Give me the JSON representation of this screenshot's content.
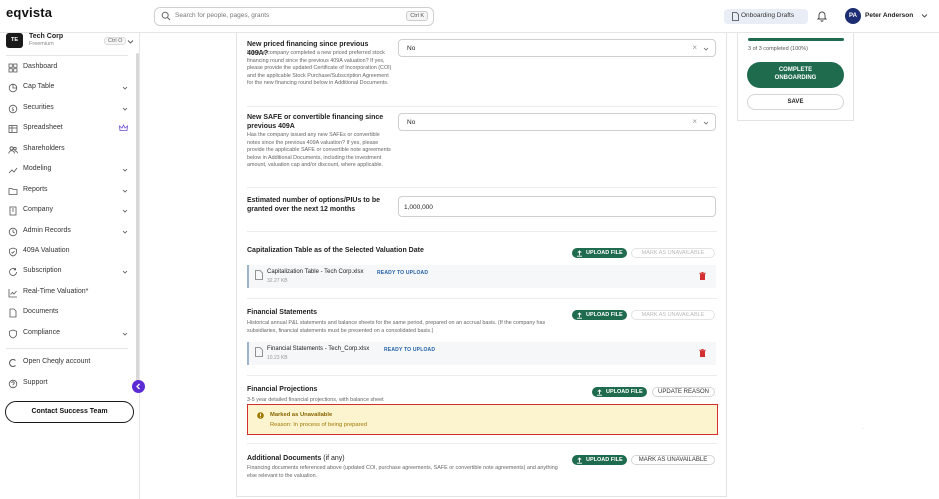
{
  "app": {
    "logo": "eqvista"
  },
  "search": {
    "placeholder": "Search for people, pages, grants",
    "shortcut": "Ctrl K"
  },
  "header": {
    "drafts_label": "Onboarding Drafts",
    "user_initials": "PA",
    "user_name": "Peter Anderson"
  },
  "company": {
    "badge": "TE",
    "name": "Tech Corp",
    "plan": "Freemium",
    "shortcut": "Ctrl O"
  },
  "sidebar": {
    "items": [
      {
        "label": "Dashboard",
        "icon": "dashboard-icon"
      },
      {
        "label": "Cap Table",
        "icon": "pie-chart-icon"
      },
      {
        "label": "Securities",
        "icon": "dollar-icon"
      },
      {
        "label": "Spreadsheet",
        "icon": "table-icon"
      },
      {
        "label": "Shareholders",
        "icon": "users-icon"
      },
      {
        "label": "Modeling",
        "icon": "modeling-icon"
      },
      {
        "label": "Reports",
        "icon": "folder-icon"
      },
      {
        "label": "Company",
        "icon": "building-icon"
      },
      {
        "label": "Admin Records",
        "icon": "records-icon"
      },
      {
        "label": "409A Valuation",
        "icon": "shield-check-icon"
      },
      {
        "label": "Subscription",
        "icon": "subscription-icon"
      },
      {
        "label": "Real-Time Valuation*",
        "icon": "trend-icon"
      },
      {
        "label": "Documents",
        "icon": "document-icon"
      },
      {
        "label": "Compliance",
        "icon": "compliance-icon"
      }
    ],
    "bottom": [
      {
        "label": "Open Cheqly account",
        "icon": "cheqly-icon"
      },
      {
        "label": "Support",
        "icon": "help-icon"
      }
    ],
    "contact_label": "Contact Success Team"
  },
  "questions": {
    "priced": {
      "title": "New priced financing since previous 409A?",
      "help": "Has the company completed a new priced preferred stock financing round since the previous 409A valuation? If yes, please provide the updated Certificate of Incorporation (COI) and the applicable Stock Purchase/Subscription Agreement for the new financing round below in Additional Documents.",
      "value": "No"
    },
    "safe": {
      "title": "New SAFE or convertible financing since previous 409A",
      "help": "Has the company issued any new SAFEs or convertible notes since the previous 409A valuation? If yes, please provide the applicable SAFE or convertible note agreements below in Additional Documents, including the investment amount, valuation cap and/or discount, where applicable.",
      "value": "No"
    },
    "options": {
      "title": "Estimated number of options/PIUs to be granted over the next 12 months",
      "value": "1,000,000"
    }
  },
  "sections": {
    "cap_table": {
      "title": "Capitalization Table as of the Selected Valuation Date",
      "upload_label": "UPLOAD FILE",
      "mark_label": "MARK AS UNAVAILABLE",
      "file": {
        "name": "Capitalization Table - Tech Corp.xlsx",
        "status": "READY TO UPLOAD",
        "size": "32.27 KB"
      }
    },
    "financials": {
      "title": "Financial Statements",
      "subtitle": "Historical annual P&L statements and balance sheets for the same period, prepared on an accrual basis. (If the company has subsidiaries, financial statements must be presented on a consolidated basis.)",
      "upload_label": "UPLOAD FILE",
      "mark_label": "MARK AS UNAVAILABLE",
      "file": {
        "name": "Financial Statements - Tech_Corp.xlsx",
        "status": "READY TO UPLOAD",
        "size": "10.23 KB"
      }
    },
    "projections": {
      "title": "Financial Projections",
      "subtitle": "3-5 year detailed financial projections, with balance sheet",
      "upload_label": "UPLOAD FILE",
      "update_label": "UPDATE REASON",
      "unavailable_title": "Marked as Unavailable",
      "unavailable_reason": "Reason: In process of being prepared"
    },
    "additional": {
      "title": "Additional Documents",
      "title_suffix": "(if any)",
      "subtitle": "Financing documents referenced above (updated COI, purchase agreements, SAFE or convertible note agreements) and anything else relevant to the valuation.",
      "upload_label": "UPLOAD FILE",
      "mark_label": "MARK AS UNAVAILABLE"
    }
  },
  "progress": {
    "text": "3 of 3 completed (100%)",
    "fraction": 1.0
  },
  "actions": {
    "complete_line1": "COMPLETE",
    "complete_line2": "ONBOARDING",
    "save_label": "SAVE"
  },
  "colors": {
    "brand_green": "#1e6b4e",
    "accent_purple": "#5b2bd4",
    "alert_red": "#d32f2f",
    "alert_bg": "#fbf4cf",
    "avatar_blue": "#1d2d74"
  }
}
